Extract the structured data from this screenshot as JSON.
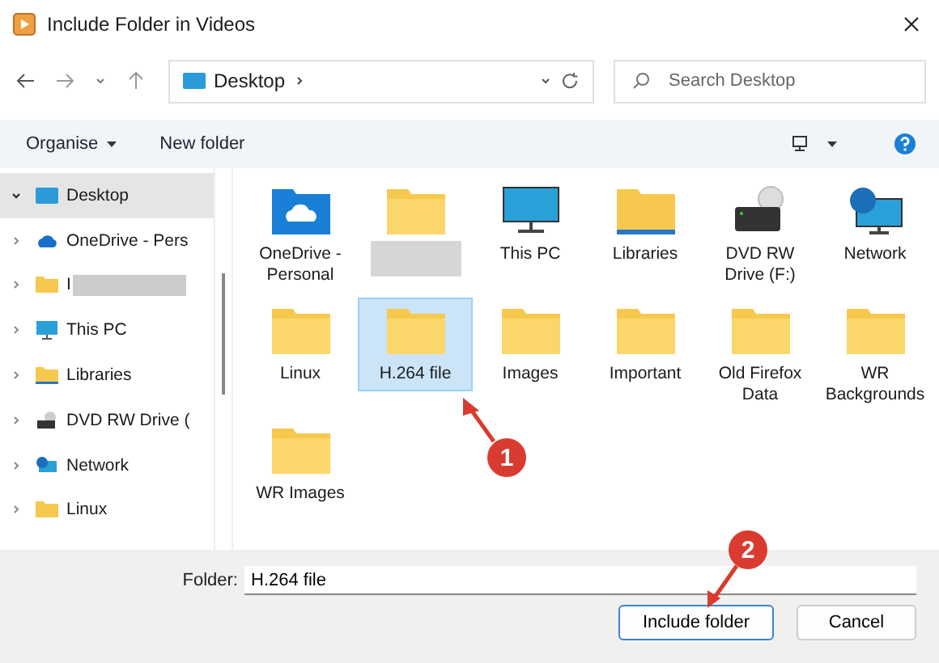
{
  "window": {
    "title": "Include Folder in Videos"
  },
  "address_bar": {
    "location": "Desktop"
  },
  "search": {
    "placeholder": "Search Desktop"
  },
  "toolbar": {
    "organise": "Organise",
    "new_folder": "New folder"
  },
  "sidebar": {
    "items": [
      {
        "label": "Desktop",
        "kind": "desktop",
        "expanded": true,
        "selected": true
      },
      {
        "label": "OneDrive - Pers",
        "kind": "cloud",
        "expanded": false,
        "selected": false
      },
      {
        "label": "I",
        "kind": "redacted",
        "expanded": false,
        "selected": false
      },
      {
        "label": "This PC",
        "kind": "pc",
        "expanded": false,
        "selected": false
      },
      {
        "label": "Libraries",
        "kind": "library",
        "expanded": false,
        "selected": false
      },
      {
        "label": "DVD RW Drive (",
        "kind": "dvd",
        "expanded": false,
        "selected": false
      },
      {
        "label": "Network",
        "kind": "network",
        "expanded": false,
        "selected": false
      },
      {
        "label": "Linux",
        "kind": "folder",
        "expanded": false,
        "selected": false
      }
    ]
  },
  "files": [
    {
      "label": "OneDrive - Personal",
      "kind": "cloud",
      "selected": false
    },
    {
      "kind": "redacted",
      "selected": false
    },
    {
      "label": "This PC",
      "kind": "pc",
      "selected": false
    },
    {
      "label": "Libraries",
      "kind": "library",
      "selected": false
    },
    {
      "label": "DVD RW Drive (F:)",
      "kind": "dvd",
      "selected": false
    },
    {
      "label": "Network",
      "kind": "network",
      "selected": false
    },
    {
      "label": "Linux",
      "kind": "folder",
      "selected": false
    },
    {
      "label": "H.264 file",
      "kind": "folder",
      "selected": true
    },
    {
      "label": "Images",
      "kind": "folder",
      "selected": false
    },
    {
      "label": "Important",
      "kind": "folder",
      "selected": false
    },
    {
      "label": "Old Firefox Data",
      "kind": "folder",
      "selected": false
    },
    {
      "label": "WR Backgrounds",
      "kind": "folder",
      "selected": false
    },
    {
      "label": "WR Images",
      "kind": "folder",
      "selected": false
    }
  ],
  "footer": {
    "folder_label": "Folder:",
    "folder_value": "H.264 file",
    "buttons": [
      "Include folder",
      "Cancel"
    ]
  },
  "callouts": [
    {
      "number": "1"
    },
    {
      "number": "2"
    }
  ]
}
